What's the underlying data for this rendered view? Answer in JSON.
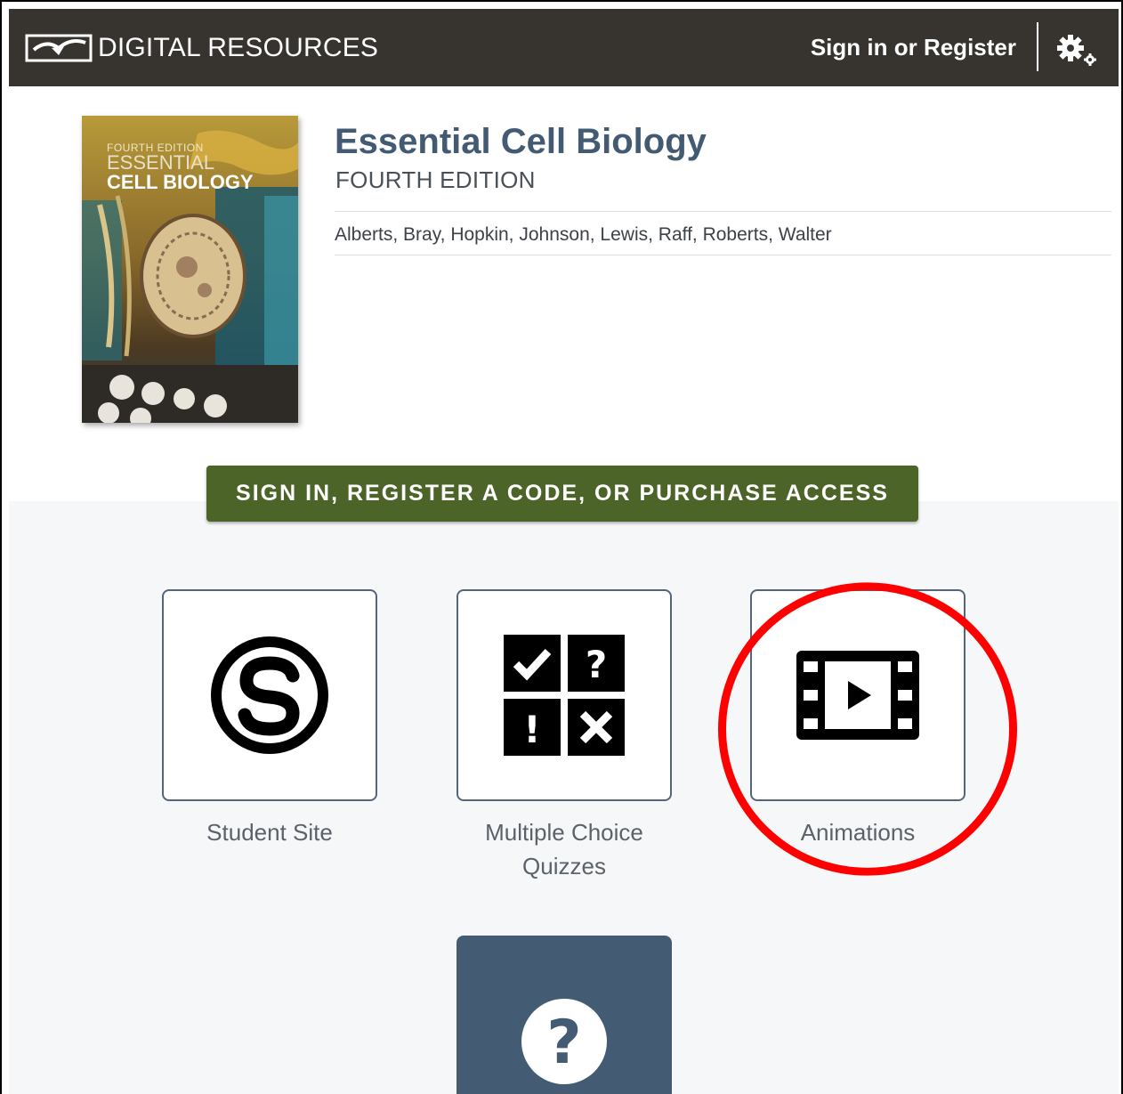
{
  "header": {
    "brand": "DIGITAL RESOURCES",
    "signin": "Sign in or Register",
    "bg_color": "#37342f"
  },
  "product": {
    "title": "Essential Cell Biology",
    "edition": "FOURTH EDITION",
    "authors": "Alberts, Bray, Hopkin, Johnson, Lewis, Raff, Roberts, Walter",
    "cover": {
      "edition_text": "FOURTH EDITION",
      "line1": "ESSENTIAL",
      "line2": "CELL BIOLOGY"
    },
    "title_color": "#435a73"
  },
  "access_button": {
    "label": "SIGN IN, REGISTER A CODE, OR PURCHASE ACCESS",
    "color": "#4c6428"
  },
  "tiles": [
    {
      "label": "Student Site",
      "icon": "student-site-s-icon"
    },
    {
      "label": "Multiple Choice Quizzes",
      "icon": "quiz-grid-icon"
    },
    {
      "label": "Animations",
      "icon": "film-play-icon"
    },
    {
      "label": "",
      "icon": "help-question-icon"
    }
  ],
  "annotation": {
    "color": "#ff0000",
    "target": "Animations"
  }
}
